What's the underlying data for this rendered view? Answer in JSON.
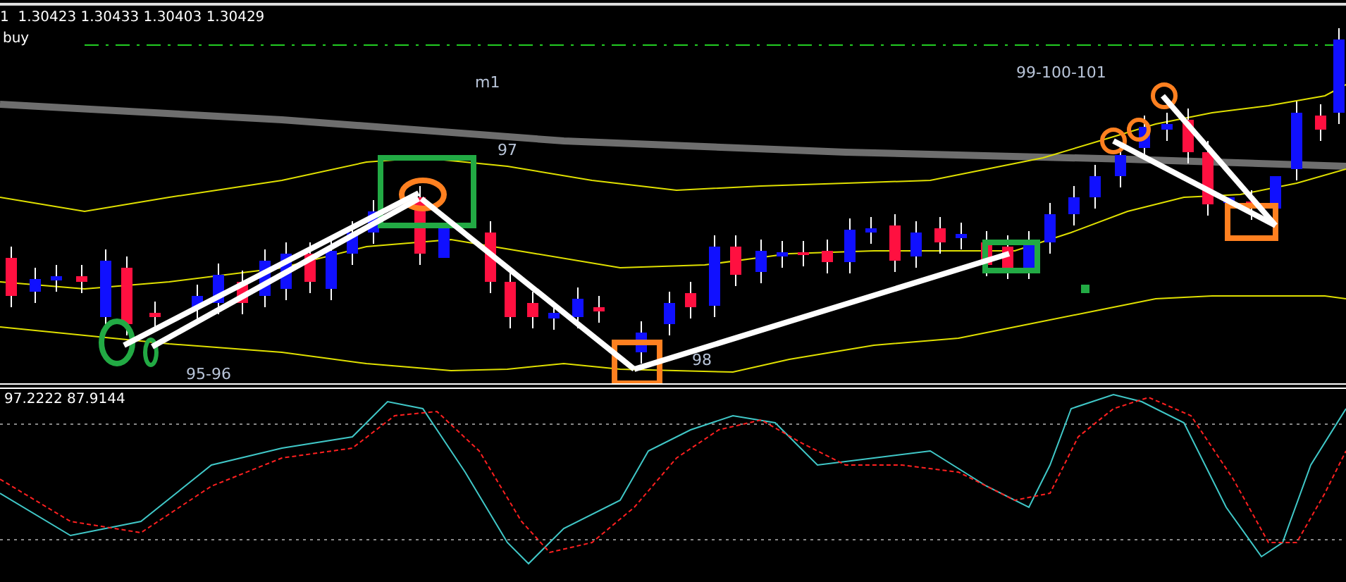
{
  "main_chart": {
    "header": "1  1.30423 1.30433 1.30403 1.30429",
    "level_label": "buy",
    "annotations": [
      {
        "text": "m1"
      },
      {
        "text": "97"
      },
      {
        "text": "99-100-101"
      },
      {
        "text": "95-96"
      },
      {
        "text": "98"
      }
    ]
  },
  "indicator": {
    "header": "97.2222 87.9144"
  }
}
